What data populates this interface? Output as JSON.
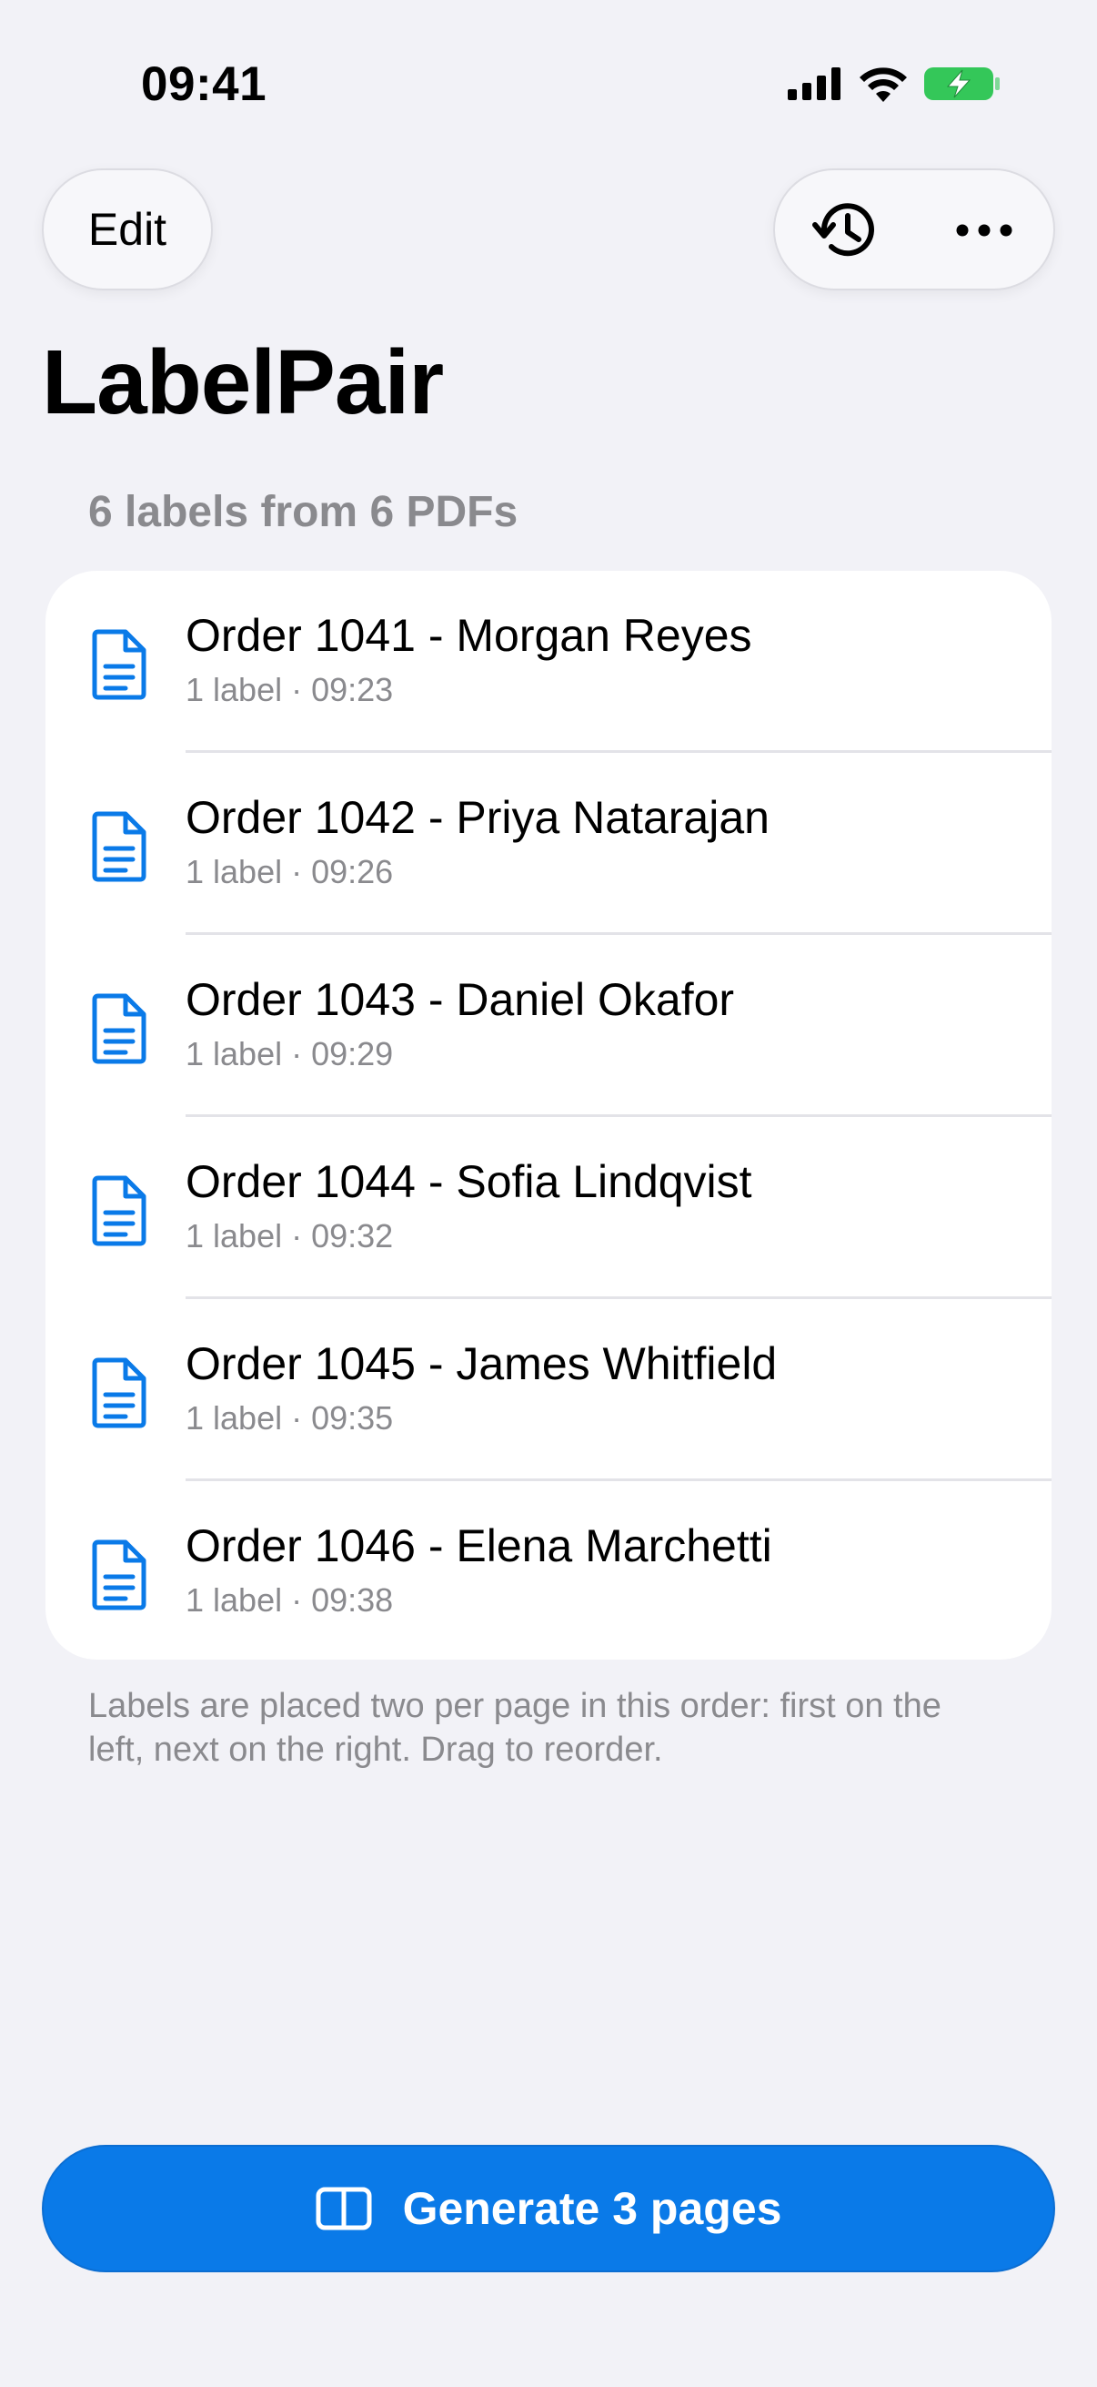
{
  "status_bar": {
    "time": "09:41",
    "icons": [
      "cellular-signal-icon",
      "wifi-icon",
      "battery-charging-icon"
    ],
    "battery_color": "#34C759"
  },
  "toolbar": {
    "edit_label": "Edit",
    "history_icon": "history-clock-icon",
    "more_icon": "ellipsis-icon"
  },
  "page": {
    "title": "LabelPair",
    "section_header": "6 labels from 6 PDFs",
    "footer_note": "Labels are placed two per page in this order: first on the left, next on the right. Drag to reorder."
  },
  "labels": [
    {
      "title": "Order 1041 - Morgan Reyes",
      "subtitle": "1 label · 09:23",
      "icon": "document-icon"
    },
    {
      "title": "Order 1042 - Priya Natarajan",
      "subtitle": "1 label · 09:26",
      "icon": "document-icon"
    },
    {
      "title": "Order 1043 - Daniel Okafor",
      "subtitle": "1 label · 09:29",
      "icon": "document-icon"
    },
    {
      "title": "Order 1044 - Sofia Lindqvist",
      "subtitle": "1 label · 09:32",
      "icon": "document-icon"
    },
    {
      "title": "Order 1045 - James Whitfield",
      "subtitle": "1 label · 09:35",
      "icon": "document-icon"
    },
    {
      "title": "Order 1046 - Elena Marchetti",
      "subtitle": "1 label · 09:38",
      "icon": "document-icon"
    }
  ],
  "generate_button": {
    "label": "Generate 3 pages",
    "icon": "two-page-layout-icon"
  },
  "colors": {
    "accent": "#0A7AE8",
    "background": "#F2F2F7",
    "secondary_text": "#8A8A8E"
  }
}
